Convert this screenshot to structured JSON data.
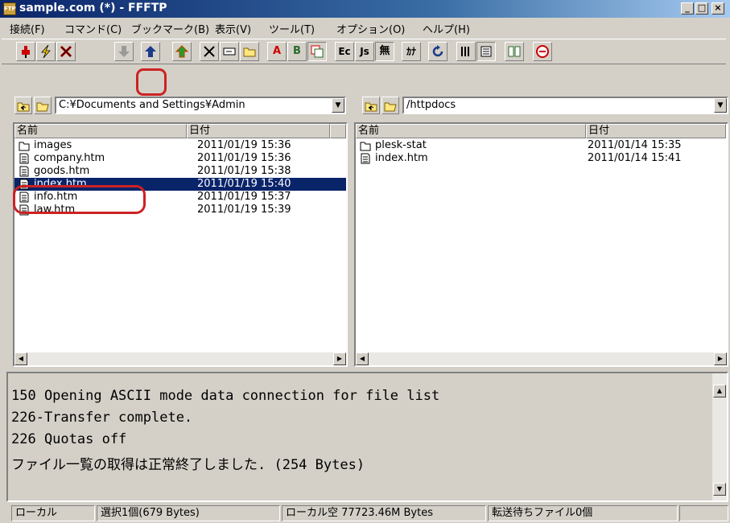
{
  "window": {
    "title": "sample.com (*) - FFFTP",
    "app_icon": "ftp-app-icon"
  },
  "menu": [
    {
      "label": "接続(F)"
    },
    {
      "label": "コマンド(C)"
    },
    {
      "label": "ブックマーク(B)"
    },
    {
      "label": "表示(V)"
    },
    {
      "label": "ツール(T)"
    },
    {
      "label": "オプション(O)"
    },
    {
      "label": "ヘルプ(H)"
    }
  ],
  "toolbar": {
    "letters": {
      "ascii": "A",
      "binary": "B",
      "euc": "Ec",
      "jis": "Js",
      "no_conv": "無",
      "kana": "ｶﾅ"
    }
  },
  "local": {
    "path": "C:¥Documents and Settings¥Admin",
    "columns": {
      "name": "名前",
      "date": "日付"
    },
    "files": [
      {
        "name": "images",
        "date": "2011/01/19 15:36",
        "type": "folder"
      },
      {
        "name": "company.htm",
        "date": "2011/01/19 15:36",
        "type": "file"
      },
      {
        "name": "goods.htm",
        "date": "2011/01/19 15:38",
        "type": "file"
      },
      {
        "name": "index.htm",
        "date": "2011/01/19 15:40",
        "type": "file",
        "selected": true
      },
      {
        "name": "info.htm",
        "date": "2011/01/19 15:37",
        "type": "file"
      },
      {
        "name": "law.htm",
        "date": "2011/01/19 15:39",
        "type": "file"
      }
    ]
  },
  "remote": {
    "path": "/httpdocs",
    "columns": {
      "name": "名前",
      "date": "日付"
    },
    "files": [
      {
        "name": "plesk-stat",
        "date": "2011/01/14 15:35",
        "type": "folder"
      },
      {
        "name": "index.htm",
        "date": "2011/01/14 15:41",
        "type": "file"
      }
    ]
  },
  "log": [
    "150 Opening ASCII mode data connection for file list",
    "226-Transfer complete.",
    "226 Quotas off",
    "ファイル一覧の取得は正常終了しました. (254 Bytes)"
  ],
  "status": {
    "mode": "ローカル",
    "selection": "選択1個(679 Bytes)",
    "free_space": "ローカル空 77723.46M Bytes",
    "queue": "転送待ちファイル0個"
  },
  "colors": {
    "titlebar": "#0a246a",
    "selection": "#0a246a",
    "highlight": "#cc2222",
    "face": "#d4d0c8"
  }
}
